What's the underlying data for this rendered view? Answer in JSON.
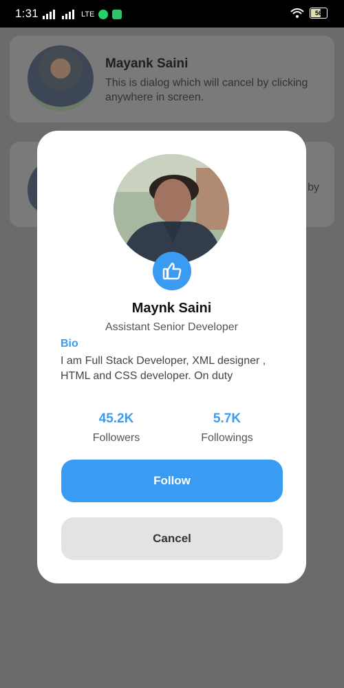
{
  "status_bar": {
    "time": "1:31",
    "net_label": "LTE",
    "battery_level": "56"
  },
  "background_cards": [
    {
      "name": "Mayank Saini",
      "description": "This is dialog which will cancel by clicking anywhere in screen."
    },
    {
      "fragment": "by"
    }
  ],
  "dialog": {
    "name": "Maynk Saini",
    "role": "Assistant Senior Developer",
    "bio_label": "Bio",
    "bio_text": "I am Full Stack Developer, XML designer , HTML and CSS developer. On duty",
    "stats": [
      {
        "value": "45.2K",
        "label": "Followers"
      },
      {
        "value": "5.7K",
        "label": "Followings"
      }
    ],
    "follow_label": "Follow",
    "cancel_label": "Cancel"
  },
  "colors": {
    "accent": "#3a9bf3",
    "overlay": "#6b6b6b",
    "cancel_bg": "#e3e3e3"
  },
  "icons": [
    "signal-icon",
    "whatsapp-icon",
    "app-icon",
    "wifi-icon",
    "battery-icon",
    "thumbs-up-icon"
  ]
}
